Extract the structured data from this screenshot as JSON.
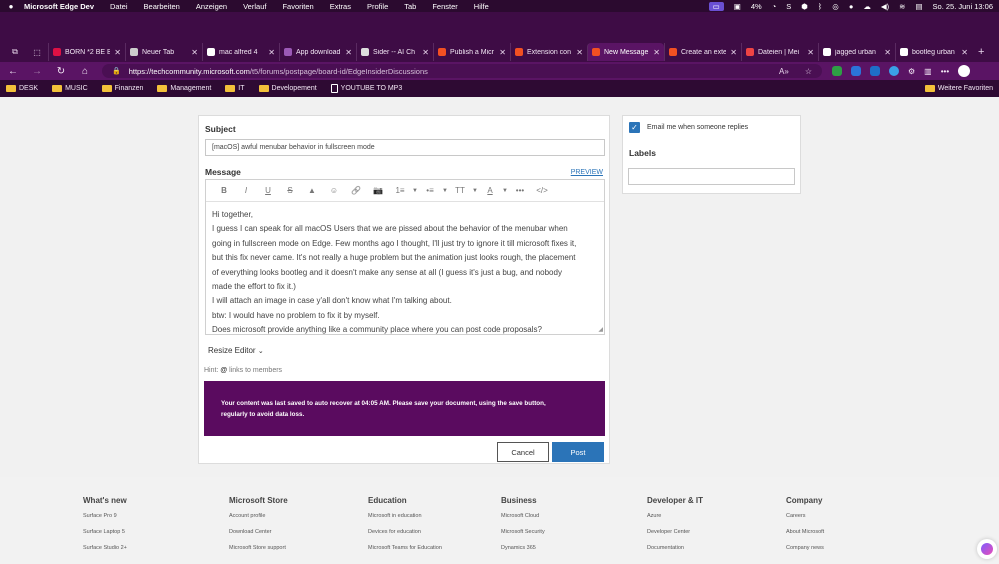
{
  "macos_menubar": {
    "app_name": "Microsoft Edge Dev",
    "menus": [
      "Datei",
      "Bearbeiten",
      "Anzeigen",
      "Verlauf",
      "Favoriten",
      "Extras",
      "Profile",
      "Tab",
      "Fenster",
      "Hilfe"
    ],
    "battery_percent": "4%",
    "datetime": "So. 25. Juni 13:06"
  },
  "tabs": [
    {
      "title": "BORN *2 BE B",
      "color": "#d14",
      "active": false
    },
    {
      "title": "Neuer Tab",
      "color": "#ccc",
      "active": false
    },
    {
      "title": "mac alfred 4",
      "color": "#fff",
      "active": false
    },
    {
      "title": "App download",
      "color": "#9b59b6",
      "active": false
    },
    {
      "title": "Sider -- AI Ch",
      "color": "#ddd",
      "active": false
    },
    {
      "title": "Publish a Micr",
      "color": "#f25022",
      "active": false
    },
    {
      "title": "Extension con",
      "color": "#f25022",
      "active": false
    },
    {
      "title": "New Message",
      "color": "#f25022",
      "active": true
    },
    {
      "title": "Create an exte",
      "color": "#f25022",
      "active": false
    },
    {
      "title": "Dateien | Mei",
      "color": "#e44",
      "active": false
    },
    {
      "title": "jagged urban",
      "color": "#fff",
      "active": false
    },
    {
      "title": "bootleg urban",
      "color": "#fff",
      "active": false
    }
  ],
  "address_bar": {
    "url_host": "https://techcommunity.microsoft.com",
    "url_path": "/t5/forums/postpage/board-id/EdgeInsiderDiscussions"
  },
  "bookmarks": [
    {
      "label": "DESK",
      "type": "folder"
    },
    {
      "label": "MUSIC",
      "type": "folder"
    },
    {
      "label": "Finanzen",
      "type": "folder"
    },
    {
      "label": "Management",
      "type": "folder"
    },
    {
      "label": "IT",
      "type": "folder"
    },
    {
      "label": "Developement",
      "type": "folder"
    },
    {
      "label": "YOUTUBE TO MP3",
      "type": "page"
    }
  ],
  "bookmarks_more": "Weitere Favoriten",
  "form": {
    "subject_label": "Subject",
    "subject_value": "[macOS] awful menubar behavior in fullscreen mode",
    "message_label": "Message",
    "preview_link": "PREVIEW",
    "toolbar_icons": [
      "bold",
      "italic",
      "underline",
      "strikethrough",
      "spoiler",
      "emoji",
      "link",
      "photo",
      "numbered-list",
      "bulleted-list",
      "text-size",
      "text-color",
      "more",
      "code"
    ],
    "toolbar_glyphs": [
      "B",
      "I",
      "U",
      "S",
      "▲",
      "☺",
      "🔗",
      "📷",
      "1≡",
      "•≡",
      "TT",
      "A",
      "•••",
      "</>"
    ],
    "message_lines": [
      "Hi together,",
      "I guess I can speak for all macOS Users that we are pissed about the behavior of the menubar when",
      "going in fullscreen mode on Edge. Few months ago I thought, I'll just try to ignore it till microsoft fixes it,",
      "but this fix never came. It's not really a huge problem but the animation just looks rough, the placement",
      "of everything looks bootleg and it doesn't make any sense at all (I guess it's just a bug, and nobody",
      "made the effort to fix it.)",
      "I will attach an image in case y'all don't know what I'm talking about.",
      "btw: I would have no problem to fix it by myself.",
      "Does microsoft provide anything like a community place where you can post code proposals?"
    ],
    "resize_editor": "Resize Editor",
    "hint_label": "Hint:",
    "hint_at": "@",
    "hint_text": "links to members",
    "autosave_line1": "Your content was last saved to auto recover at 04:05 AM. Please save your document, using the save button,",
    "autosave_line2": "regularly to avoid data loss.",
    "cancel": "Cancel",
    "post": "Post"
  },
  "side": {
    "email_label": "Email me when someone replies",
    "email_checked": true,
    "labels_heading": "Labels"
  },
  "footer": {
    "columns": [
      {
        "heading": "What's new",
        "links": [
          "Surface Pro 9",
          "Surface Laptop 5",
          "Surface Studio 2+"
        ]
      },
      {
        "heading": "Microsoft Store",
        "links": [
          "Account profile",
          "Download Center",
          "Microsoft Store support"
        ]
      },
      {
        "heading": "Education",
        "links": [
          "Microsoft in education",
          "Devices for education",
          "Microsoft Teams for Education"
        ]
      },
      {
        "heading": "Business",
        "links": [
          "Microsoft Cloud",
          "Microsoft Security",
          "Dynamics 365"
        ]
      },
      {
        "heading": "Developer & IT",
        "links": [
          "Azure",
          "Developer Center",
          "Documentation"
        ]
      },
      {
        "heading": "Company",
        "links": [
          "Careers",
          "About Microsoft",
          "Company news"
        ]
      }
    ]
  },
  "colors": {
    "accent": "#2b74b8",
    "autosave_bg": "#5a0b5f",
    "chrome_purple": "#5a1464"
  }
}
